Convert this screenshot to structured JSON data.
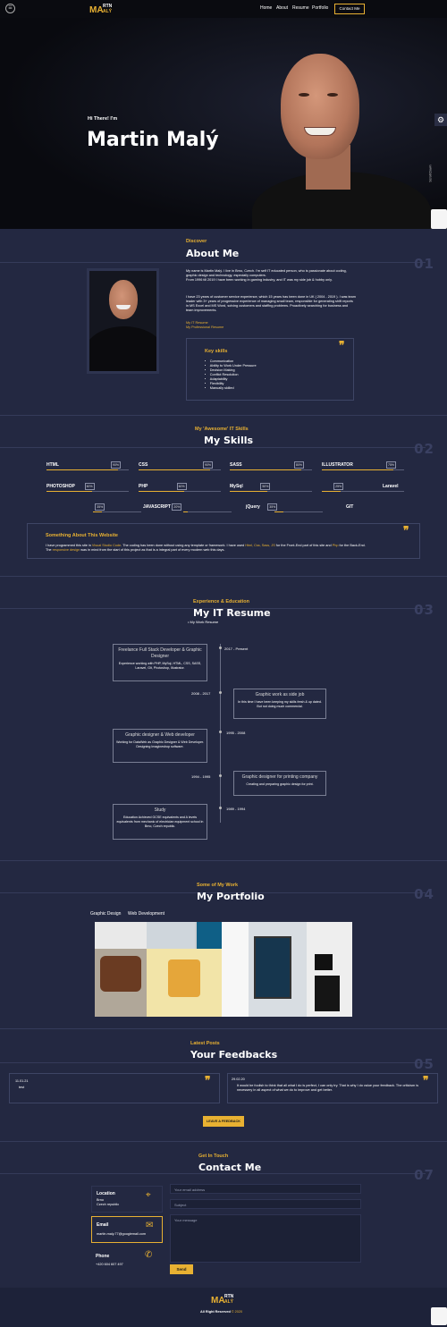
{
  "nav": {
    "logo_ma": "MA",
    "logo_rtn": "RTN",
    "logo_aly": "ALÝ",
    "links": [
      "Home",
      "About",
      "Resume",
      "Portfolio"
    ],
    "contact_label": "Contact Me"
  },
  "hero": {
    "greeting": "Hi There! I'm",
    "name": "Martin Malý",
    "scroll_label": "Scroll Down"
  },
  "about": {
    "kicker": "Discover",
    "title": "About Me",
    "number": "01",
    "p1": "My name is Martin Malý. I live in Brno, Czech. I'm self IT educated person, who is passionate about coding, graphic design and technology, especially computers.",
    "p1b": "From 1996 till 2019 I have been working in gaming industry, and IT was my side job & hobby only.",
    "p2": "I have 23 years of customer service experience, which 15 years has been done in UK ( 2004 - 2019 ). I was team leader with 3+ years of progressive experience of managing small team, responsible for generating shift reports in MS Excel and MS Word, solving customers and staffing problems. Proactively searching for business and team improvements.",
    "link1": "My IT Resume",
    "link2": "My Professional Resume",
    "key_title": "Key skills",
    "key_skills": [
      "Communication",
      "Ability to Work Under Pressure",
      "Decision Making",
      "Conflict Resolution",
      "Adaptability",
      "Flexibility",
      "Manually skilled"
    ]
  },
  "skills": {
    "kicker": "My 'Awesome' IT Skills",
    "title": "My Skills",
    "number": "02",
    "items": [
      {
        "name": "HTML",
        "pct": "90%"
      },
      {
        "name": "CSS",
        "pct": "90%"
      },
      {
        "name": "SASS",
        "pct": "80%"
      },
      {
        "name": "ILLUSTRATOR",
        "pct": "75%"
      },
      {
        "name": "PHOTOSHOP",
        "pct": "60%"
      },
      {
        "name": "PHP",
        "pct": "60%"
      },
      {
        "name": "MySql",
        "pct": "50%"
      },
      {
        "name": "Laravel",
        "pct": "25%"
      },
      {
        "name": "JAVASCRIPT",
        "pct": "35%"
      },
      {
        "name": "jQuery",
        "pct": "20%"
      },
      {
        "name": "GIT",
        "pct": "35%"
      }
    ],
    "website_title": "Something About This Website",
    "website_text_1": "I have programmed this site in ",
    "website_hl_1": "Visual Studio Code",
    "website_text_2": ". The coding has been done without using any template or framework. I have used ",
    "website_hl_2": "Html, Css, Sass, JS",
    "website_text_3": " for the Front-End part of this site and ",
    "website_hl_3": "Php",
    "website_text_4": " for the Back-End.",
    "website_text_5": "The ",
    "website_hl_4": "responsive design",
    "website_text_6": " was in mind from the start of this project as that is a integral part of every modern web this days."
  },
  "resume": {
    "kicker": "Experience & Education",
    "title": "My IT Resume",
    "number": "03",
    "sub": "My Work Resume",
    "entries": [
      {
        "date": "2017 - Present",
        "title": "Freelance Full Stack Developer & Graphic Designer",
        "text": "Experience working with PHP, MySql, HTML, CSS, SASS, Laravel, Git, Photoshop, Illustrator."
      },
      {
        "date": "2008 - 2017",
        "title": "Graphic work as side job",
        "text": "In this time I have been keeping my skills fresh & up dated. But not doing much commercial."
      },
      {
        "date": "1995 - 2008",
        "title": "Graphic designer & Web developer",
        "text": "Working for DataWeb as Graphic Designer & Web Developer. Designing Imagineshop software."
      },
      {
        "date": "1994 - 1995",
        "title": "Graphic designer for printing company",
        "text": "Creating and preparing graphic design for print."
      },
      {
        "date": "1989 - 1994",
        "title": "Study",
        "text": "Education Achieved GCSE equivalents and A levels equivalents from mechanic of electrician equipment school in Brno, Czech republic."
      }
    ]
  },
  "portfolio": {
    "kicker": "Some of My Work",
    "title": "My Portfolio",
    "number": "04",
    "filters": [
      "Graphic Design",
      "Web Development"
    ]
  },
  "feedback": {
    "kicker": "Latest Posts",
    "title": "Your Feedbacks",
    "number": "05",
    "posts": [
      {
        "date": "11.01.21",
        "text": "test"
      },
      {
        "date": "29.02.20",
        "text": "It would be foolish to think that all what I do is perfect, I can only try. That is why I do value your feedback. The criticism is neсessery in all aspect of what we do to improve and get better."
      }
    ],
    "button": "LEAVE A FEEDBACK"
  },
  "contact": {
    "kicker": "Get In Touch",
    "title": "Contact Me",
    "number": "07",
    "location_title": "Location",
    "location_line1": "Brno",
    "location_line2": "Czech republic",
    "email_title": "Email",
    "email_value": "martin.maly.77@googlemail.com",
    "phone_title": "Phone",
    "phone_value": "+420 604 607 497",
    "ph_email": "Your email address",
    "ph_subject": "Subject",
    "ph_message": "Your message",
    "send": "Send"
  },
  "footer": {
    "rights": "All Right Reserved",
    "year": "© 2020"
  }
}
